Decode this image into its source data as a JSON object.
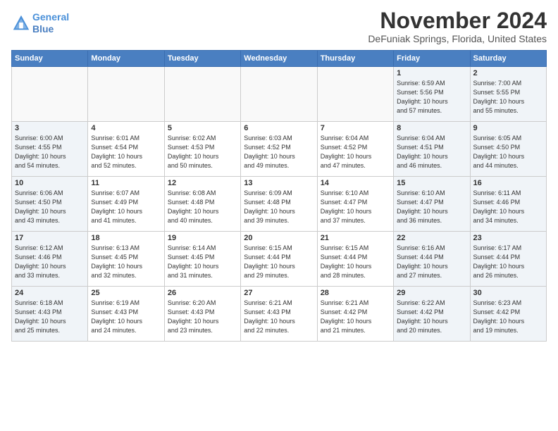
{
  "header": {
    "logo_line1": "General",
    "logo_line2": "Blue",
    "month": "November 2024",
    "location": "DeFuniak Springs, Florida, United States"
  },
  "days_of_week": [
    "Sunday",
    "Monday",
    "Tuesday",
    "Wednesday",
    "Thursday",
    "Friday",
    "Saturday"
  ],
  "weeks": [
    [
      {
        "day": "",
        "type": "empty",
        "info": ""
      },
      {
        "day": "",
        "type": "empty",
        "info": ""
      },
      {
        "day": "",
        "type": "empty",
        "info": ""
      },
      {
        "day": "",
        "type": "empty",
        "info": ""
      },
      {
        "day": "",
        "type": "empty",
        "info": ""
      },
      {
        "day": "1",
        "type": "weekend",
        "info": "Sunrise: 6:59 AM\nSunset: 5:56 PM\nDaylight: 10 hours\nand 57 minutes."
      },
      {
        "day": "2",
        "type": "weekend",
        "info": "Sunrise: 7:00 AM\nSunset: 5:55 PM\nDaylight: 10 hours\nand 55 minutes."
      }
    ],
    [
      {
        "day": "3",
        "type": "weekend",
        "info": "Sunrise: 6:00 AM\nSunset: 4:55 PM\nDaylight: 10 hours\nand 54 minutes."
      },
      {
        "day": "4",
        "type": "weekday",
        "info": "Sunrise: 6:01 AM\nSunset: 4:54 PM\nDaylight: 10 hours\nand 52 minutes."
      },
      {
        "day": "5",
        "type": "weekday",
        "info": "Sunrise: 6:02 AM\nSunset: 4:53 PM\nDaylight: 10 hours\nand 50 minutes."
      },
      {
        "day": "6",
        "type": "weekday",
        "info": "Sunrise: 6:03 AM\nSunset: 4:52 PM\nDaylight: 10 hours\nand 49 minutes."
      },
      {
        "day": "7",
        "type": "weekday",
        "info": "Sunrise: 6:04 AM\nSunset: 4:52 PM\nDaylight: 10 hours\nand 47 minutes."
      },
      {
        "day": "8",
        "type": "weekend",
        "info": "Sunrise: 6:04 AM\nSunset: 4:51 PM\nDaylight: 10 hours\nand 46 minutes."
      },
      {
        "day": "9",
        "type": "weekend",
        "info": "Sunrise: 6:05 AM\nSunset: 4:50 PM\nDaylight: 10 hours\nand 44 minutes."
      }
    ],
    [
      {
        "day": "10",
        "type": "weekend",
        "info": "Sunrise: 6:06 AM\nSunset: 4:50 PM\nDaylight: 10 hours\nand 43 minutes."
      },
      {
        "day": "11",
        "type": "weekday",
        "info": "Sunrise: 6:07 AM\nSunset: 4:49 PM\nDaylight: 10 hours\nand 41 minutes."
      },
      {
        "day": "12",
        "type": "weekday",
        "info": "Sunrise: 6:08 AM\nSunset: 4:48 PM\nDaylight: 10 hours\nand 40 minutes."
      },
      {
        "day": "13",
        "type": "weekday",
        "info": "Sunrise: 6:09 AM\nSunset: 4:48 PM\nDaylight: 10 hours\nand 39 minutes."
      },
      {
        "day": "14",
        "type": "weekday",
        "info": "Sunrise: 6:10 AM\nSunset: 4:47 PM\nDaylight: 10 hours\nand 37 minutes."
      },
      {
        "day": "15",
        "type": "weekend",
        "info": "Sunrise: 6:10 AM\nSunset: 4:47 PM\nDaylight: 10 hours\nand 36 minutes."
      },
      {
        "day": "16",
        "type": "weekend",
        "info": "Sunrise: 6:11 AM\nSunset: 4:46 PM\nDaylight: 10 hours\nand 34 minutes."
      }
    ],
    [
      {
        "day": "17",
        "type": "weekend",
        "info": "Sunrise: 6:12 AM\nSunset: 4:46 PM\nDaylight: 10 hours\nand 33 minutes."
      },
      {
        "day": "18",
        "type": "weekday",
        "info": "Sunrise: 6:13 AM\nSunset: 4:45 PM\nDaylight: 10 hours\nand 32 minutes."
      },
      {
        "day": "19",
        "type": "weekday",
        "info": "Sunrise: 6:14 AM\nSunset: 4:45 PM\nDaylight: 10 hours\nand 31 minutes."
      },
      {
        "day": "20",
        "type": "weekday",
        "info": "Sunrise: 6:15 AM\nSunset: 4:44 PM\nDaylight: 10 hours\nand 29 minutes."
      },
      {
        "day": "21",
        "type": "weekday",
        "info": "Sunrise: 6:15 AM\nSunset: 4:44 PM\nDaylight: 10 hours\nand 28 minutes."
      },
      {
        "day": "22",
        "type": "weekend",
        "info": "Sunrise: 6:16 AM\nSunset: 4:44 PM\nDaylight: 10 hours\nand 27 minutes."
      },
      {
        "day": "23",
        "type": "weekend",
        "info": "Sunrise: 6:17 AM\nSunset: 4:44 PM\nDaylight: 10 hours\nand 26 minutes."
      }
    ],
    [
      {
        "day": "24",
        "type": "weekend",
        "info": "Sunrise: 6:18 AM\nSunset: 4:43 PM\nDaylight: 10 hours\nand 25 minutes."
      },
      {
        "day": "25",
        "type": "weekday",
        "info": "Sunrise: 6:19 AM\nSunset: 4:43 PM\nDaylight: 10 hours\nand 24 minutes."
      },
      {
        "day": "26",
        "type": "weekday",
        "info": "Sunrise: 6:20 AM\nSunset: 4:43 PM\nDaylight: 10 hours\nand 23 minutes."
      },
      {
        "day": "27",
        "type": "weekday",
        "info": "Sunrise: 6:21 AM\nSunset: 4:43 PM\nDaylight: 10 hours\nand 22 minutes."
      },
      {
        "day": "28",
        "type": "weekday",
        "info": "Sunrise: 6:21 AM\nSunset: 4:42 PM\nDaylight: 10 hours\nand 21 minutes."
      },
      {
        "day": "29",
        "type": "weekend",
        "info": "Sunrise: 6:22 AM\nSunset: 4:42 PM\nDaylight: 10 hours\nand 20 minutes."
      },
      {
        "day": "30",
        "type": "weekend",
        "info": "Sunrise: 6:23 AM\nSunset: 4:42 PM\nDaylight: 10 hours\nand 19 minutes."
      }
    ]
  ]
}
